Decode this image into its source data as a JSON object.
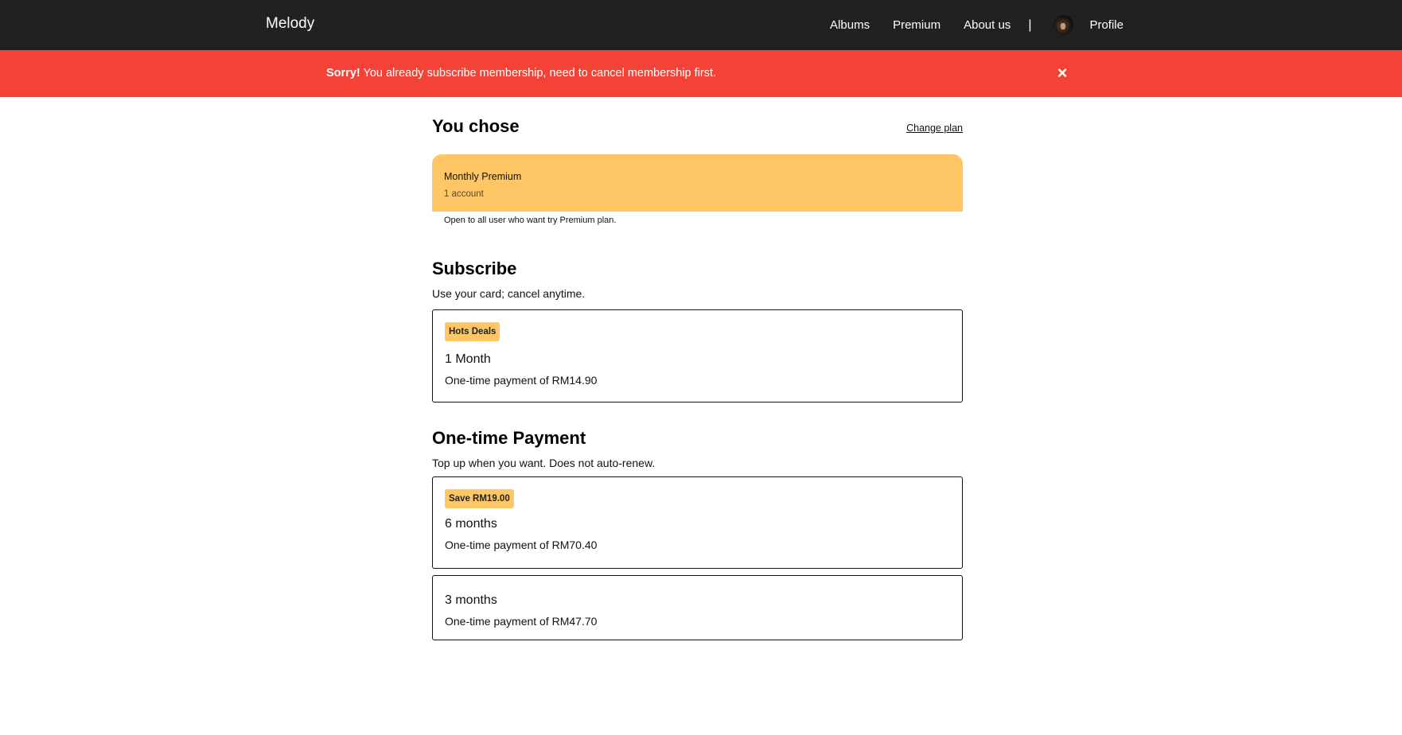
{
  "navbar": {
    "brand": "Melody",
    "links": [
      "Albums",
      "Premium",
      "About us"
    ],
    "separator": "|",
    "avatar_icon": "user-avatar-icon",
    "profile_label": "Profile"
  },
  "alert": {
    "strong": "Sorry!",
    "message": " You already subscribe membership, need to cancel membership first.",
    "close_symbol": "×",
    "close_icon": "close-icon",
    "color": "#f44336"
  },
  "chosen": {
    "heading": "You chose",
    "change_plan": "Change plan",
    "plan_name": "Monthly Premium",
    "plan_accounts": "1 account",
    "plan_desc": "Open to all user who want try Premium plan.",
    "accent_color": "#fec665"
  },
  "subscribe": {
    "heading": "Subscribe",
    "subtitle": "Use your card; cancel anytime.",
    "options": [
      {
        "badge": "Hots Deals",
        "title": "1 Month",
        "price": "One-time payment of RM14.90"
      }
    ]
  },
  "one_time": {
    "heading": "One-time Payment",
    "subtitle": "Top up when you want. Does not auto-renew.",
    "options": [
      {
        "badge": "Save RM19.00",
        "title": "6 months",
        "price": "One-time payment of RM70.40"
      },
      {
        "title": "3 months",
        "price": "One-time payment of RM47.70"
      }
    ]
  }
}
